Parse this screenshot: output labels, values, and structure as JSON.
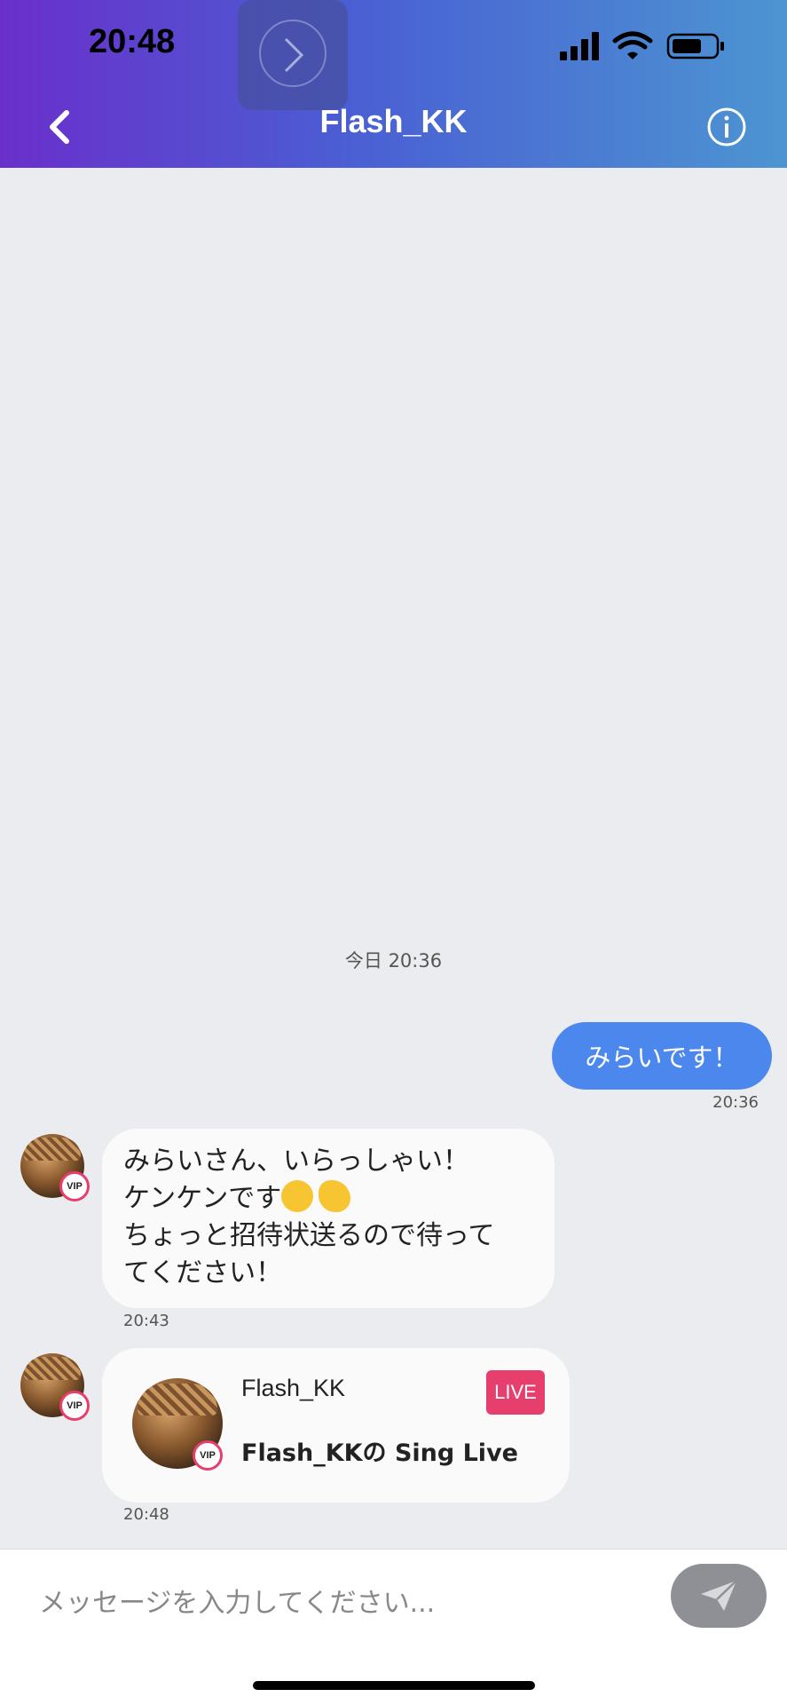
{
  "status_bar": {
    "time": "20:48"
  },
  "nav": {
    "title": "Flash_KK"
  },
  "messages": {
    "date_separator": "今日 20:36",
    "outgoing": {
      "text": "みらいです！",
      "time": "20:36"
    },
    "incoming_text": {
      "lines": [
        "みらいさん、いらっしゃい！",
        "ケンケンです",
        "ちょっと招待状送るので待って",
        "てください！"
      ],
      "time": "20:43"
    },
    "live_card": {
      "user": "Flash_KK",
      "badge": "LIVE",
      "title": "Flash_KKの Sing Live",
      "time": "20:48"
    },
    "vip_label": "VIP"
  },
  "composer": {
    "placeholder": "メッセージを入力してください..."
  },
  "colors": {
    "header_start": "#6A2FCB",
    "header_end": "#4C95D2",
    "bubble_out": "#4B87EC",
    "live_badge": "#E63E6D",
    "send_button": "#8E9095"
  }
}
